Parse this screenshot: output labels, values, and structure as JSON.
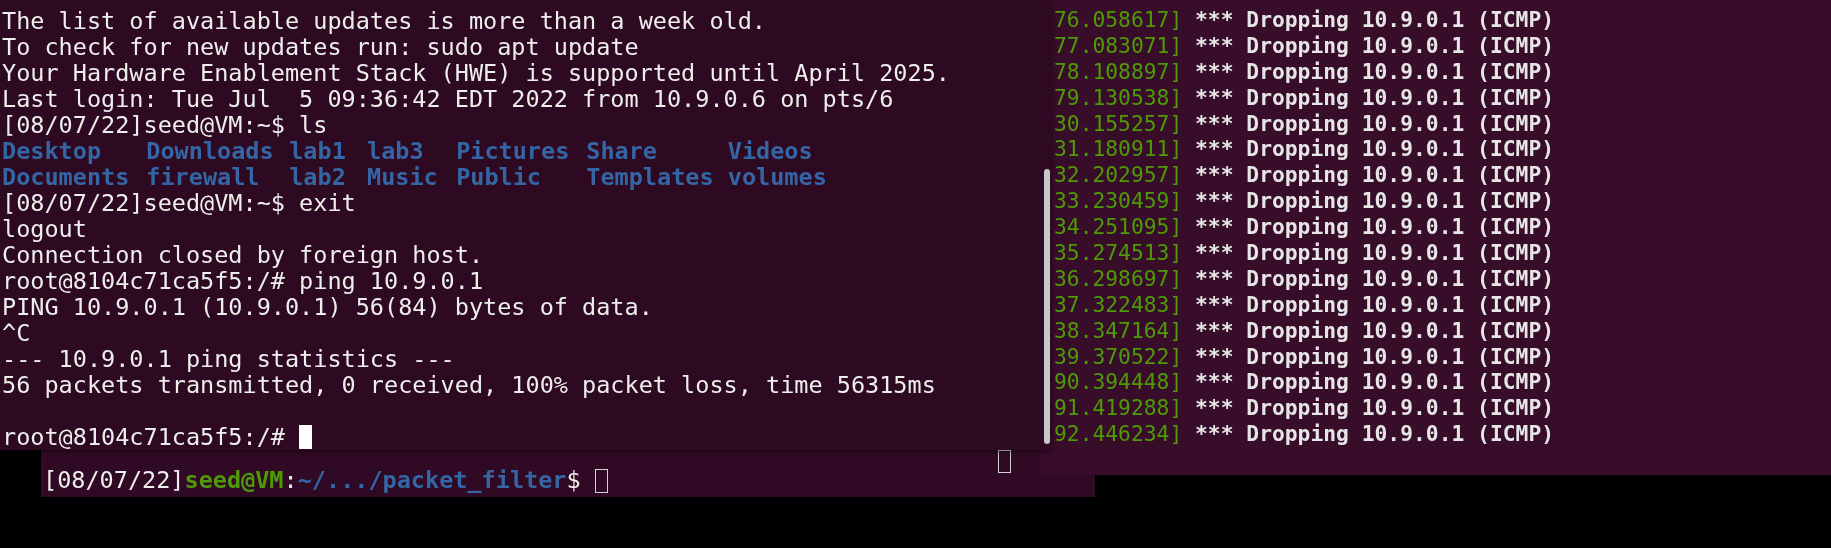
{
  "background_terminal": {
    "lines": [
      {
        "kind": "prompt",
        "focused": false,
        "segments": [
          {
            "kind": "plain",
            "text": "[08/07/22]"
          },
          {
            "kind": "user",
            "text": "seed@VM"
          },
          {
            "kind": "plain",
            "text": ":"
          },
          {
            "kind": "path",
            "text": "~/.../packet_filter"
          },
          {
            "kind": "plain",
            "text": "$ "
          }
        ]
      }
    ]
  },
  "log_terminal": {
    "lines": [
      {
        "time": "76.058617]",
        "message": "*** Dropping 10.9.0.1 (ICMP)"
      },
      {
        "time": "77.083071]",
        "message": "*** Dropping 10.9.0.1 (ICMP)"
      },
      {
        "time": "78.108897]",
        "message": "*** Dropping 10.9.0.1 (ICMP)"
      },
      {
        "time": "79.130538]",
        "message": "*** Dropping 10.9.0.1 (ICMP)"
      },
      {
        "time": "30.155257]",
        "message": "*** Dropping 10.9.0.1 (ICMP)"
      },
      {
        "time": "31.180911]",
        "message": "*** Dropping 10.9.0.1 (ICMP)"
      },
      {
        "time": "32.202957]",
        "message": "*** Dropping 10.9.0.1 (ICMP)"
      },
      {
        "time": "33.230459]",
        "message": "*** Dropping 10.9.0.1 (ICMP)"
      },
      {
        "time": "34.251095]",
        "message": "*** Dropping 10.9.0.1 (ICMP)"
      },
      {
        "time": "35.274513]",
        "message": "*** Dropping 10.9.0.1 (ICMP)"
      },
      {
        "time": "36.298697]",
        "message": "*** Dropping 10.9.0.1 (ICMP)"
      },
      {
        "time": "37.322483]",
        "message": "*** Dropping 10.9.0.1 (ICMP)"
      },
      {
        "time": "38.347164]",
        "message": "*** Dropping 10.9.0.1 (ICMP)"
      },
      {
        "time": "39.370522]",
        "message": "*** Dropping 10.9.0.1 (ICMP)"
      },
      {
        "time": "90.394448]",
        "message": "*** Dropping 10.9.0.1 (ICMP)"
      },
      {
        "time": "91.419288]",
        "message": "*** Dropping 10.9.0.1 (ICMP)"
      },
      {
        "time": "92.446234]",
        "message": "*** Dropping 10.9.0.1 (ICMP)"
      }
    ]
  },
  "main_terminal": {
    "lines": [
      {
        "kind": "text",
        "segments": [
          {
            "kind": "plain",
            "text": "The list of available updates is more than a week old."
          }
        ]
      },
      {
        "kind": "text",
        "segments": [
          {
            "kind": "plain",
            "text": "To check for new updates run: sudo apt update"
          }
        ]
      },
      {
        "kind": "text",
        "segments": [
          {
            "kind": "plain",
            "text": "Your Hardware Enablement Stack (HWE) is supported until April 2025."
          }
        ]
      },
      {
        "kind": "text",
        "segments": [
          {
            "kind": "plain",
            "text": "Last login: Tue Jul  5 09:36:42 EDT 2022 from 10.9.0.6 on pts/6"
          }
        ]
      },
      {
        "kind": "text",
        "segments": [
          {
            "kind": "plain",
            "text": "[08/07/22]seed@VM:~$ ls"
          }
        ]
      },
      {
        "kind": "files",
        "items": [
          "Desktop",
          "Downloads",
          "lab1",
          "lab3",
          "Pictures",
          "Share",
          "Videos"
        ]
      },
      {
        "kind": "files",
        "items": [
          "Documents",
          "firewall",
          "lab2",
          "Music",
          "Public",
          "Templates",
          "volumes"
        ]
      },
      {
        "kind": "text",
        "segments": [
          {
            "kind": "plain",
            "text": "[08/07/22]seed@VM:~$ exit"
          }
        ]
      },
      {
        "kind": "text",
        "segments": [
          {
            "kind": "plain",
            "text": "logout"
          }
        ]
      },
      {
        "kind": "text",
        "segments": [
          {
            "kind": "plain",
            "text": "Connection closed by foreign host."
          }
        ]
      },
      {
        "kind": "text",
        "segments": [
          {
            "kind": "plain",
            "text": "root@8104c71ca5f5:/# ping 10.9.0.1"
          }
        ]
      },
      {
        "kind": "text",
        "segments": [
          {
            "kind": "plain",
            "text": "PING 10.9.0.1 (10.9.0.1) 56(84) bytes of data."
          }
        ]
      },
      {
        "kind": "text",
        "segments": [
          {
            "kind": "plain",
            "text": "^C"
          }
        ]
      },
      {
        "kind": "text",
        "segments": [
          {
            "kind": "plain",
            "text": "--- 10.9.0.1 ping statistics ---"
          }
        ]
      },
      {
        "kind": "text",
        "segments": [
          {
            "kind": "plain",
            "text": "56 packets transmitted, 0 received, 100% packet loss, time 56315ms"
          }
        ]
      },
      {
        "kind": "blank"
      },
      {
        "kind": "prompt",
        "focused": true,
        "segments": [
          {
            "kind": "plain",
            "text": "root@8104c71ca5f5:/# "
          }
        ]
      }
    ]
  }
}
